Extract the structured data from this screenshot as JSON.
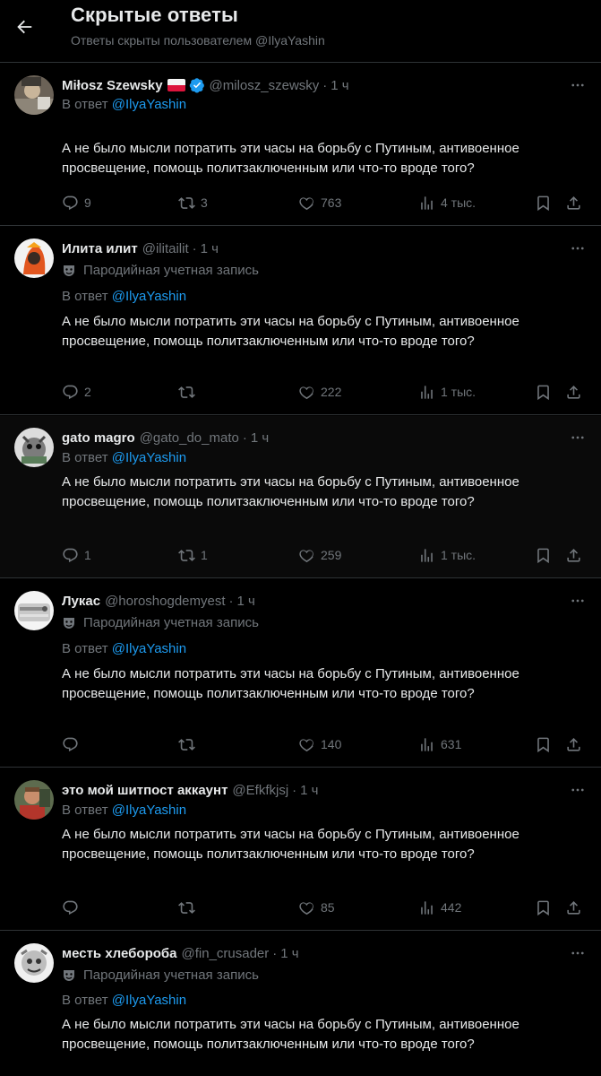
{
  "header": {
    "title": "Скрытые ответы",
    "subtitle": "Ответы скрыты пользователем @IlyaYashin"
  },
  "reply_prefix": "В ответ",
  "reply_mention": "@IlyaYashin",
  "parody_label": "Пародийная учетная запись",
  "tweets": [
    {
      "name": "Miłosz Szewsky",
      "handle": "@milosz_szewsky",
      "time": "1 ч",
      "flag": "poland-flag",
      "verified": true,
      "parody": false,
      "text": "А не было мысли потратить эти часы на борьбу с Путиным, антивоенное просвещение, помощь политзаключенным или что-то вроде того?",
      "replies": "9",
      "retweets": "3",
      "likes": "763",
      "views": "4 тыс."
    },
    {
      "name": "Илита илит",
      "handle": "@ilitailit",
      "time": "1 ч",
      "verified": false,
      "parody": true,
      "text": "А не было мысли потратить эти часы на борьбу с Путиным, антивоенное просвещение, помощь политзаключенным или что-то вроде того?",
      "replies": "2",
      "retweets": "",
      "likes": "222",
      "views": "1 тыс."
    },
    {
      "name": "gato magro",
      "handle": "@gato_do_mato",
      "time": "1 ч",
      "verified": false,
      "parody": false,
      "text": "А не было мысли потратить эти часы на борьбу с Путиным, антивоенное просвещение, помощь политзаключенным или что-то вроде того?",
      "replies": "1",
      "retweets": "1",
      "likes": "259",
      "views": "1 тыс."
    },
    {
      "name": "Лукас",
      "handle": "@horoshogdemyest",
      "time": "1 ч",
      "verified": false,
      "parody": true,
      "text": "А не было мысли потратить эти часы на борьбу с Путиным, антивоенное просвещение, помощь политзаключенным или что-то вроде того?",
      "replies": "",
      "retweets": "",
      "likes": "140",
      "views": "631"
    },
    {
      "name": "это мой шитпост аккаунт",
      "handle": "@Efkfkjsj",
      "time": "1 ч",
      "verified": false,
      "parody": false,
      "text": "А не было мысли потратить эти часы на борьбу с Путиным, антивоенное просвещение, помощь политзаключенным или что-то вроде того?",
      "replies": "",
      "retweets": "",
      "likes": "85",
      "views": "442"
    },
    {
      "name": "месть хлебороба",
      "handle": "@fin_crusader",
      "time": "1 ч",
      "verified": false,
      "parody": true,
      "text": "А не было мысли потратить эти часы на борьбу с Путиным, антивоенное просвещение, помощь политзаключенным или что-то вроде того?"
    }
  ],
  "colors": {
    "background": "#000000",
    "text": "#e7e9ea",
    "muted": "#71767b",
    "accent": "#1d9bf0",
    "divider": "#2f3336"
  }
}
